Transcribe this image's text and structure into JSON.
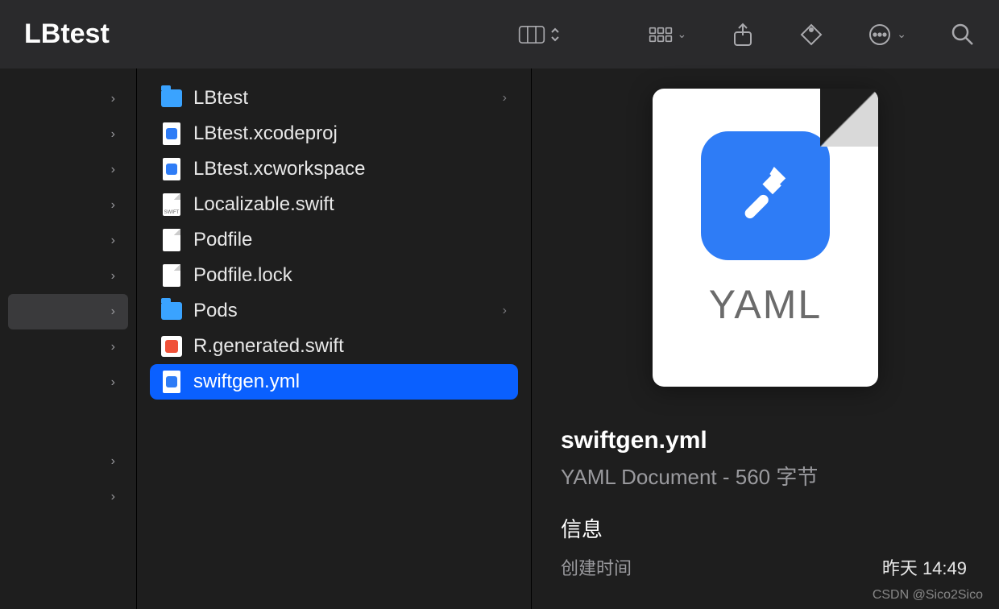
{
  "toolbar": {
    "title": "LBtest"
  },
  "sidebar": {
    "items": [
      {
        "selected": false
      },
      {
        "selected": false
      },
      {
        "selected": false
      },
      {
        "selected": false
      },
      {
        "selected": false
      },
      {
        "selected": false
      },
      {
        "selected": true
      },
      {
        "selected": false
      },
      {
        "selected": false
      }
    ],
    "lower_items": [
      {
        "selected": false
      },
      {
        "selected": false
      }
    ]
  },
  "files": [
    {
      "name": "LBtest",
      "type": "folder",
      "has_children": true,
      "selected": false
    },
    {
      "name": "LBtest.xcodeproj",
      "type": "xcodeproj",
      "has_children": false,
      "selected": false
    },
    {
      "name": "LBtest.xcworkspace",
      "type": "xcworkspace",
      "has_children": false,
      "selected": false
    },
    {
      "name": "Localizable.swift",
      "type": "swiftdoc",
      "has_children": false,
      "selected": false
    },
    {
      "name": "Podfile",
      "type": "doc",
      "has_children": false,
      "selected": false
    },
    {
      "name": "Podfile.lock",
      "type": "doc",
      "has_children": false,
      "selected": false
    },
    {
      "name": "Pods",
      "type": "folder",
      "has_children": true,
      "selected": false
    },
    {
      "name": "R.generated.swift",
      "type": "swift",
      "has_children": false,
      "selected": false
    },
    {
      "name": "swiftgen.yml",
      "type": "yaml",
      "has_children": false,
      "selected": true
    }
  ],
  "preview": {
    "ext_label": "YAML",
    "filename": "swiftgen.yml",
    "kind": "YAML Document",
    "size": "560 字节",
    "section_info": "信息",
    "created_label": "创建时间",
    "created_value": "昨天 14:49"
  },
  "watermark": "CSDN @Sico2Sico"
}
